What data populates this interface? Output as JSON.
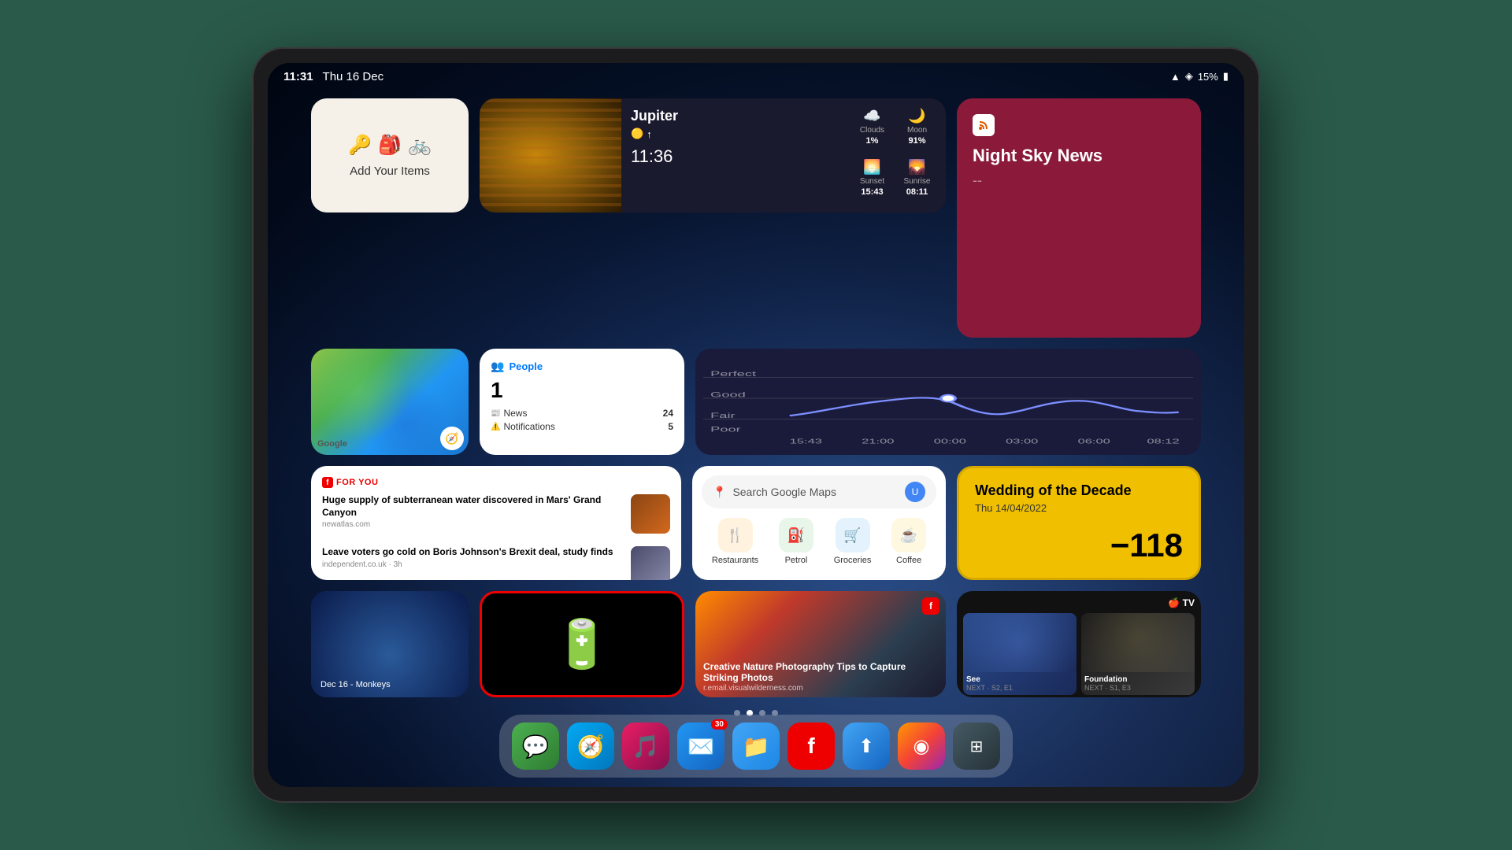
{
  "device": {
    "time": "11:31",
    "date": "Thu 16 Dec",
    "battery": "15%",
    "signal": "▲"
  },
  "widgets": {
    "add_items": {
      "label": "Add Your Items"
    },
    "jupiter": {
      "location": "Jupiter",
      "temp_icon": "🟡",
      "temp_arrow": "↑",
      "time": "11:36",
      "clouds_label": "Clouds",
      "clouds_value": "1%",
      "moon_label": "Moon",
      "moon_value": "91%",
      "sunset_label": "Sunset",
      "sunset_value": "15:43",
      "sunrise_label": "Sunrise",
      "sunrise_value": "08:11"
    },
    "night_sky": {
      "title": "Night Sky News",
      "dash": "--"
    },
    "maps_small": {
      "logo": "Google"
    },
    "people": {
      "app": "People",
      "count": "1",
      "news_label": "News",
      "news_count": "24",
      "notif_label": "Notifications",
      "notif_count": "5"
    },
    "news": {
      "for_you": "FOR YOU",
      "article1_headline": "Huge supply of subterranean water discovered in Mars' Grand Canyon",
      "article1_source": "newatlas.com",
      "article2_headline": "Leave voters go cold on Boris Johnson's Brexit deal, study finds",
      "article2_source": "independent.co.uk · 3h"
    },
    "maps_search": {
      "placeholder": "Search Google Maps",
      "restaurant": "Restaurants",
      "petrol": "Petrol",
      "groceries": "Groceries",
      "coffee": "Coffee"
    },
    "calendar": {
      "event": "Wedding of the Decade",
      "date": "Thu 14/04/2022",
      "countdown": "−118"
    },
    "reminder": {
      "text": "Dec 16 - Monkeys"
    },
    "nature": {
      "title": "Creative Nature Photography Tips to Capture Striking Photos",
      "source": "r.email.visualwilderness.com"
    },
    "appletv": {
      "show1_title": "See",
      "show1_next": "NEXT · S2, E1",
      "show2_title": "Foundation",
      "show2_next": "NEXT · S1, E3"
    }
  },
  "dock": {
    "apps": [
      {
        "name": "Messages",
        "icon": "💬",
        "badge": null
      },
      {
        "name": "Safari",
        "icon": "🧭",
        "badge": null
      },
      {
        "name": "Music",
        "icon": "🎵",
        "badge": null
      },
      {
        "name": "Mail",
        "icon": "✉️",
        "badge": "30"
      },
      {
        "name": "Files",
        "icon": "📁",
        "badge": null
      },
      {
        "name": "Flipboard",
        "icon": "f",
        "badge": null
      },
      {
        "name": "App Store",
        "icon": "⬆",
        "badge": null
      },
      {
        "name": "Colors",
        "icon": "◉",
        "badge": null
      },
      {
        "name": "Screenshot+",
        "icon": "⊞",
        "badge": null
      }
    ]
  },
  "page_dots": [
    1,
    2,
    3,
    4
  ],
  "active_dot": 2
}
